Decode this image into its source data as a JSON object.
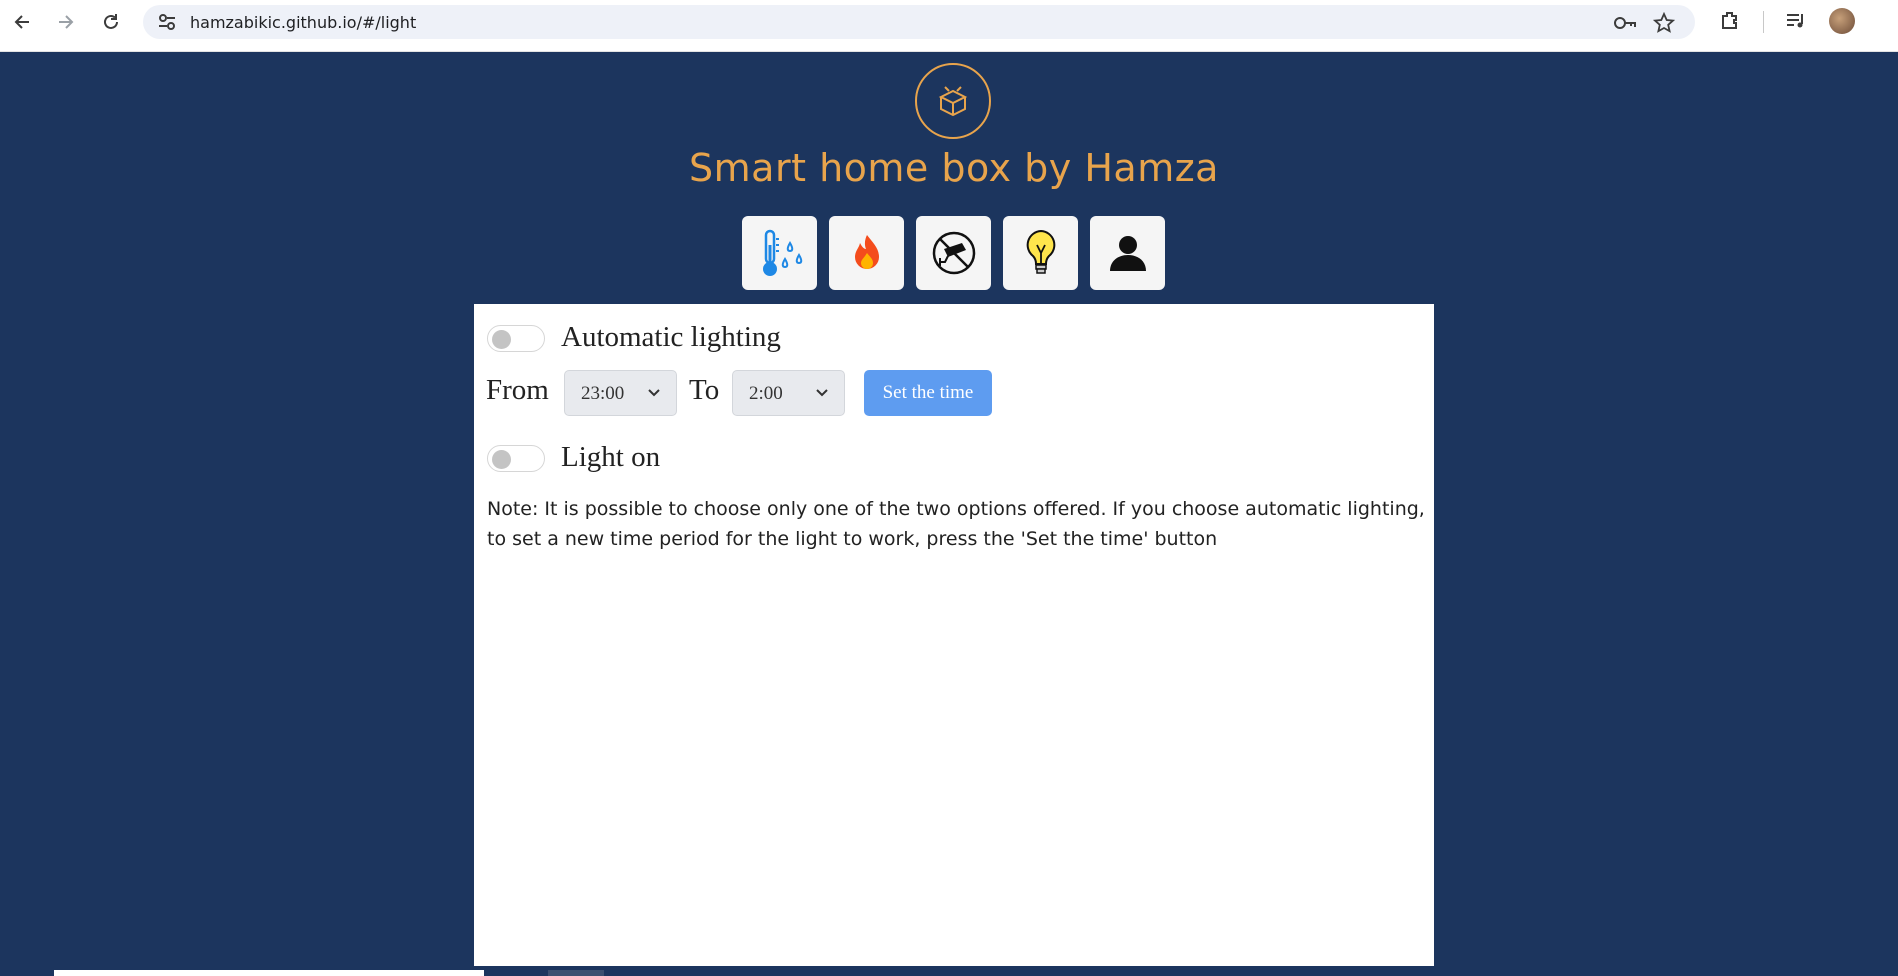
{
  "browser": {
    "url": "hamzabikic.github.io/#/light",
    "icons": [
      "back-arrow-icon",
      "forward-arrow-icon",
      "reload-icon",
      "site-info-icon",
      "password-key-icon",
      "bookmark-star-icon",
      "extensions-icon",
      "media-queue-icon",
      "profile-avatar"
    ]
  },
  "header": {
    "logo_icon": "box-icon",
    "title": "Smart home box by Hamza"
  },
  "tabs": [
    {
      "icon": "thermometer-humidity-icon"
    },
    {
      "icon": "fire-icon"
    },
    {
      "icon": "security-camera-icon"
    },
    {
      "icon": "light-bulb-icon"
    },
    {
      "icon": "user-icon"
    }
  ],
  "light": {
    "auto_label": "Automatic lighting",
    "auto_enabled": false,
    "from_label": "From",
    "from_value": "23:00",
    "to_label": "To",
    "to_value": "2:00",
    "set_button": "Set the time",
    "light_label": "Light on",
    "light_enabled": false,
    "note": "Note: It is possible to choose only one of the two options offered. If you choose automatic lighting, to set a new time period for the light to work, press the 'Set the time' button"
  },
  "colors": {
    "background": "#1c355e",
    "accent": "#e8a44c",
    "button": "#5e9cf0"
  }
}
